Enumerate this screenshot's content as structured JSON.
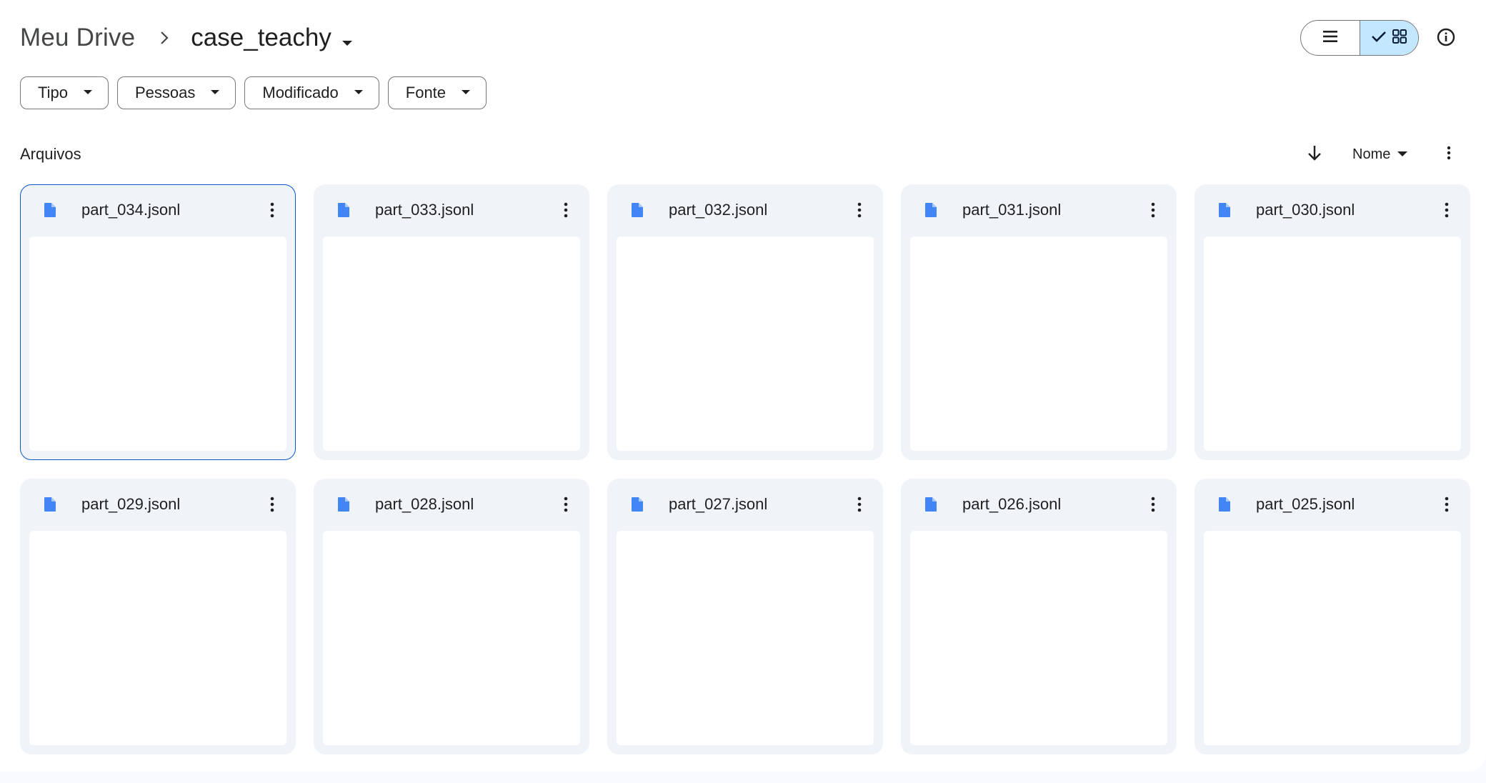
{
  "breadcrumb": {
    "root": "Meu Drive",
    "current": "case_teachy"
  },
  "view_toggle": {
    "list_icon": "list-icon",
    "grid_icon": "grid-icon",
    "active": "grid"
  },
  "filters": [
    {
      "label": "Tipo"
    },
    {
      "label": "Pessoas"
    },
    {
      "label": "Modificado"
    },
    {
      "label": "Fonte"
    }
  ],
  "files_section": {
    "title": "Arquivos",
    "sort_field": "Nome",
    "sort_direction": "descending"
  },
  "files": [
    {
      "name": "part_034.jsonl",
      "selected": true
    },
    {
      "name": "part_033.jsonl",
      "selected": false
    },
    {
      "name": "part_032.jsonl",
      "selected": false
    },
    {
      "name": "part_031.jsonl",
      "selected": false
    },
    {
      "name": "part_030.jsonl",
      "selected": false
    },
    {
      "name": "part_029.jsonl",
      "selected": false
    },
    {
      "name": "part_028.jsonl",
      "selected": false
    },
    {
      "name": "part_027.jsonl",
      "selected": false
    },
    {
      "name": "part_026.jsonl",
      "selected": false
    },
    {
      "name": "part_025.jsonl",
      "selected": false
    }
  ],
  "colors": {
    "accent": "#0b57d0",
    "file_icon": "#4285f4",
    "active_toggle": "#c2e7ff",
    "card_bg": "#f0f4f9"
  }
}
